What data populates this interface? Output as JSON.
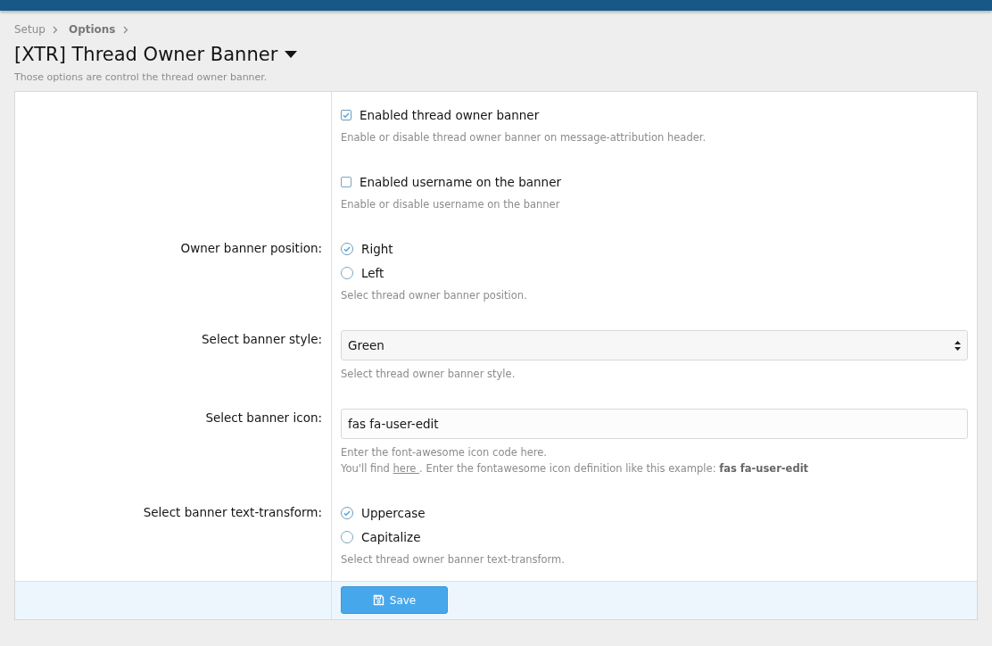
{
  "breadcrumb": [
    {
      "label": "Setup",
      "current": false
    },
    {
      "label": "Options",
      "current": true
    }
  ],
  "title": "[XTR] Thread Owner Banner",
  "description": "Those options are control the thread owner banner.",
  "rows": [
    {
      "kind": "checkbox",
      "options": [
        {
          "label": "Enabled thread owner banner",
          "checked": true
        }
      ],
      "hint": "Enable or disable thread owner banner on message-attribution header."
    },
    {
      "kind": "checkbox",
      "options": [
        {
          "label": "Enabled username on the banner",
          "checked": false
        }
      ],
      "hint": "Enable or disable username on the banner"
    },
    {
      "kind": "radio",
      "label": "Owner banner position:",
      "options": [
        {
          "label": "Right",
          "selected": true
        },
        {
          "label": "Left",
          "selected": false
        }
      ],
      "hint": "Selec thread owner banner position."
    },
    {
      "kind": "select",
      "label": "Select banner style:",
      "value": "Green",
      "hint": "Select thread owner banner style."
    },
    {
      "kind": "text",
      "label": "Select banner icon:",
      "value": "fas fa-user-edit",
      "hint": "Enter the font-awesome icon code here.",
      "hint_line": {
        "before": "You'll find",
        "link": "here ",
        "after": ". Enter the fontawesome icon definition like this example: **fas fa-user-edit**"
      }
    },
    {
      "kind": "radio",
      "label": "Select banner text-transform:",
      "options": [
        {
          "label": "Uppercase",
          "selected": true
        },
        {
          "label": "Capitalize",
          "selected": false
        }
      ],
      "hint": "Select thread owner banner text-transform."
    }
  ],
  "save_button": "Save"
}
